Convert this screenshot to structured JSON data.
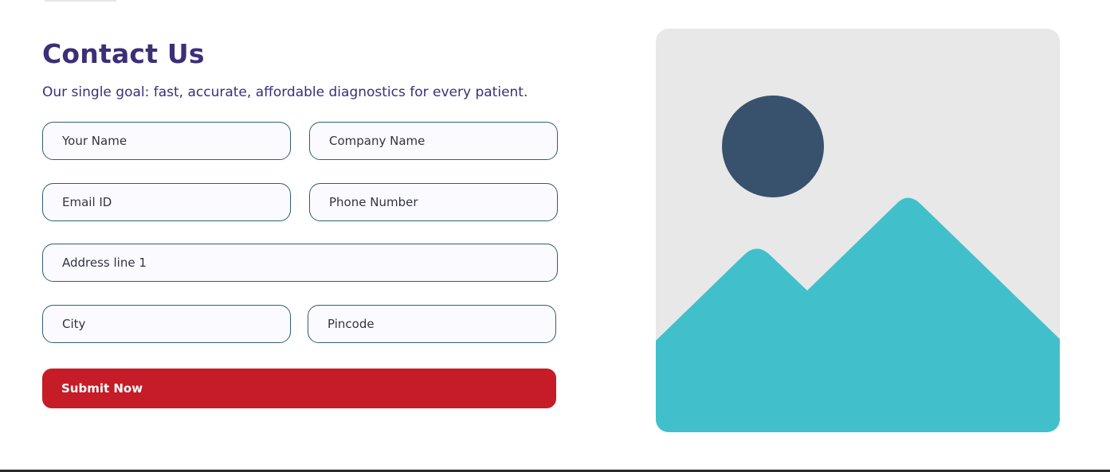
{
  "contact": {
    "title": "Contact Us",
    "subtitle": "Our single goal: fast, accurate, affordable diagnostics for every patient."
  },
  "form": {
    "name_placeholder": "Your Name",
    "company_placeholder": "Company Name",
    "email_placeholder": "Email ID",
    "phone_placeholder": "Phone Number",
    "address_placeholder": "Address line 1",
    "city_placeholder": "City",
    "pincode_placeholder": "Pincode",
    "submit_label": "Submit Now"
  },
  "hero": {
    "icon": "image-placeholder-icon",
    "colors": {
      "background": "#e8e8e8",
      "sun": "#38526d",
      "mountains": "#41c0cb"
    }
  },
  "theme": {
    "heading_color": "#3c2f77",
    "field_border": "#2e5f73",
    "submit_color": "#c51c27"
  }
}
